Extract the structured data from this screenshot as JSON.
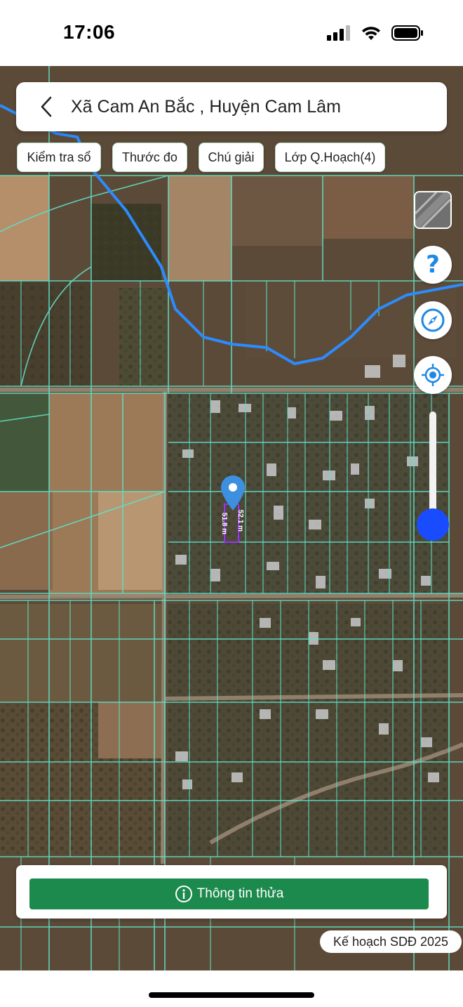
{
  "status_bar": {
    "time": "17:06"
  },
  "header": {
    "location_title": "Xã Cam An Bắc , Huyện Cam Lâm"
  },
  "chips": [
    {
      "label": "Kiểm tra sổ"
    },
    {
      "label": "Thước đo"
    },
    {
      "label": "Chú giải"
    },
    {
      "label": "Lớp Q.Hoạch(4)"
    }
  ],
  "map": {
    "parcel_dimensions": {
      "side_a": "52.1 m",
      "side_b": "51.8 m"
    },
    "zoom_slider_level": 0.15,
    "colors": {
      "parcel_lines": "#5fe0c8",
      "river": "#2b8cff",
      "selected_parcel": "#9b30ff",
      "pin": "#3d8fe0"
    }
  },
  "controls": {
    "layer_toggle_icon": "satellite-layer-icon",
    "help_icon": "question-icon",
    "compass_icon": "compass-icon",
    "locate_icon": "locate-icon"
  },
  "bottom": {
    "info_button_label": "Thông tin thửa",
    "plan_badge": "Kế hoạch SDĐ 2025"
  },
  "theme": {
    "accent_green": "#1b8a4c",
    "accent_blue": "#1e88e5"
  }
}
